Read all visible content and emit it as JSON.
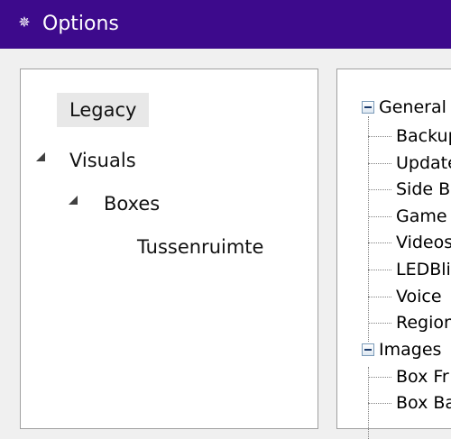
{
  "window": {
    "title": "Options",
    "title_icon": "gear-icon",
    "titlebar_color": "#3d0a8c"
  },
  "left_tree": {
    "items": [
      {
        "label": "Legacy",
        "selected": true
      },
      {
        "label": "Visuals",
        "expanded": true
      },
      {
        "label": "Boxes",
        "expanded": true
      },
      {
        "label": "Tussenruimte"
      }
    ]
  },
  "right_tree": {
    "groups": [
      {
        "label": "General",
        "children": [
          "Backup",
          "Update",
          "Side B",
          "Game",
          "Videos",
          "LEDBli",
          "Voice",
          "Region"
        ]
      },
      {
        "label": "Images",
        "children": [
          "Box Fr",
          "Box Ba"
        ]
      }
    ]
  }
}
